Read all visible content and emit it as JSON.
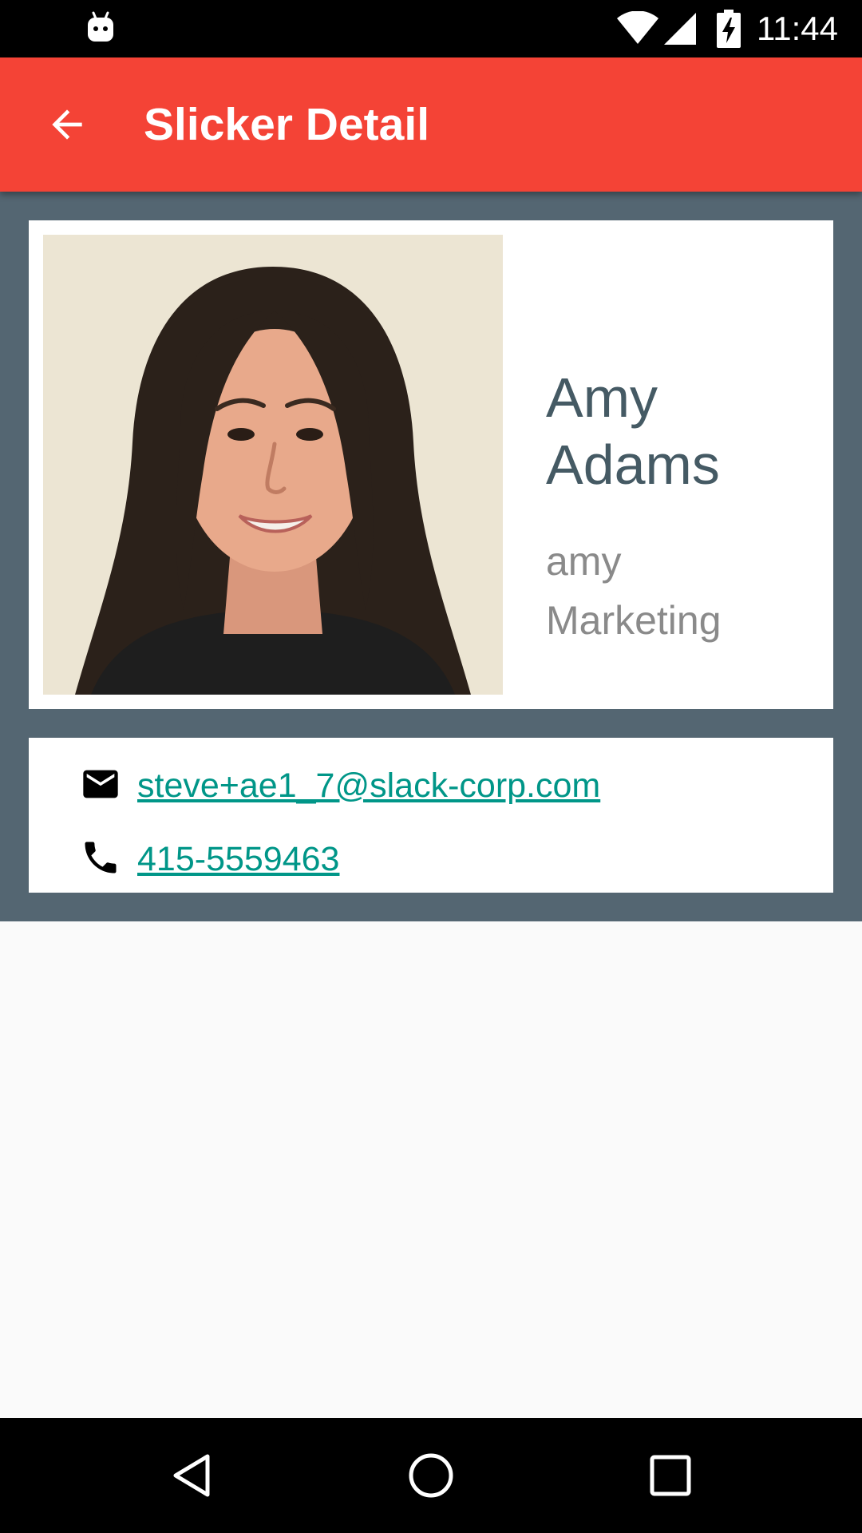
{
  "status_bar": {
    "time": "11:44",
    "icons": [
      "debug-android-icon",
      "wifi-icon",
      "cell-signal-icon",
      "battery-charging-icon"
    ]
  },
  "app_bar": {
    "title": "Slicker Detail",
    "back_icon": "arrow-back-icon",
    "color": "#f44336"
  },
  "profile": {
    "first_name": "Amy",
    "last_name": "Adams",
    "username": "amy",
    "department": "Marketing",
    "photo": "profile-photo"
  },
  "contact": {
    "email": "steve+ae1_7@slack-corp.com",
    "email_icon": "mail-icon",
    "phone": "415-5559463",
    "phone_icon": "phone-icon",
    "link_color": "#009688"
  },
  "nav_bar": {
    "icons": [
      "nav-back-icon",
      "nav-home-icon",
      "nav-recents-icon"
    ]
  },
  "colors": {
    "content_background": "#546672",
    "name_color": "#455a64",
    "meta_color": "#8a8a8a"
  }
}
